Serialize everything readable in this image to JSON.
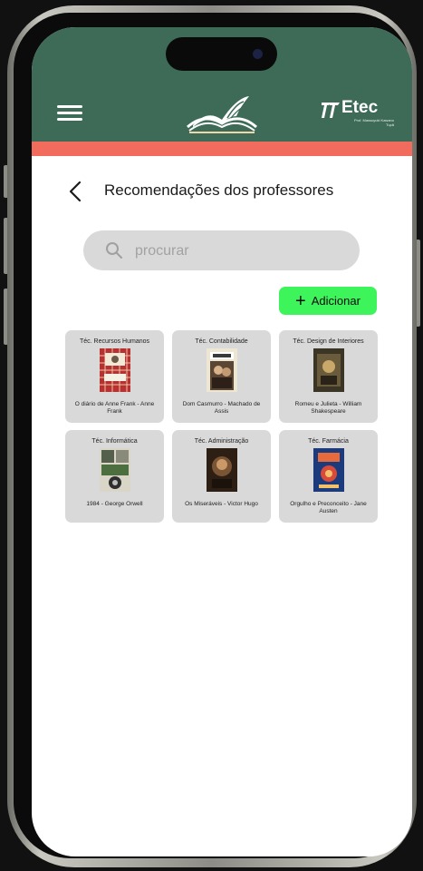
{
  "header": {
    "logo_text": "Etec",
    "logo_subtext": "Prof. Massuyuki Kawano Tupã"
  },
  "page": {
    "title": "Recomendações dos professores",
    "back_icon": "chevron-left-icon"
  },
  "search": {
    "placeholder": "procurar",
    "value": ""
  },
  "actions": {
    "add_label": "Adicionar"
  },
  "books": [
    {
      "course": "Téc. Recursos Humanos",
      "title": "O diário de Anne Frank - Anne Frank",
      "cover_color": "#c43a3a"
    },
    {
      "course": "Téc. Contabilidade",
      "title": "Dom Casmurro - Machado de Assis",
      "cover_color": "#e9e2cf"
    },
    {
      "course": "Téc. Design de Interiores",
      "title": "Romeu e Julieta - William Shakespeare",
      "cover_color": "#3a3324"
    },
    {
      "course": "Téc. Informática",
      "title": "1984 - George Orwell",
      "cover_color": "#7a8a6a"
    },
    {
      "course": "Téc. Administração",
      "title": "Os Miseráveis - Victor Hugo",
      "cover_color": "#4a3320"
    },
    {
      "course": "Téc. Farmácia",
      "title": "Orgulho e Preconceito - Jane Austen",
      "cover_color": "#1f3c7a"
    }
  ],
  "colors": {
    "header": "#3d6b58",
    "accent_strip": "#f26c5d",
    "add_button": "#3df45b",
    "card": "#d9d9d9"
  }
}
